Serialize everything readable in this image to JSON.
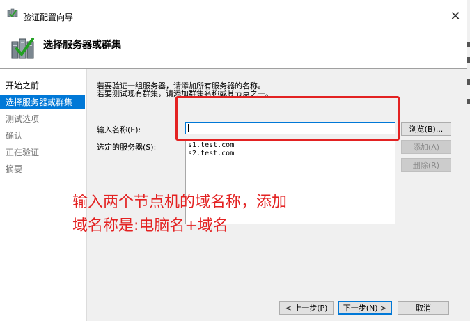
{
  "window": {
    "title": "验证配置向导",
    "close_glyph": "✕"
  },
  "header": {
    "title": "选择服务器或群集",
    "icon": "cluster-validate-icon"
  },
  "nav": {
    "items": [
      {
        "label": "开始之前",
        "state": "normal"
      },
      {
        "label": "选择服务器或群集",
        "state": "selected"
      },
      {
        "label": "测试选项",
        "state": "disabled"
      },
      {
        "label": "确认",
        "state": "disabled"
      },
      {
        "label": "正在验证",
        "state": "disabled"
      },
      {
        "label": "摘要",
        "state": "disabled"
      }
    ]
  },
  "content": {
    "desc_line1": "若要验证一组服务器，请添加所有服务器的名称。",
    "desc_line2": "若要测试现有群集，请添加群集名称或其节点之一。",
    "name_label": "输入名称(E):",
    "name_value": "",
    "servers_label": "选定的服务器(S):",
    "servers": [
      "s1.test.com",
      "s2.test.com"
    ],
    "browse_button": "浏览(B)...",
    "add_button": "添加(A)",
    "remove_button": "删除(R)"
  },
  "footer": {
    "prev_button": "< 上一步(P)",
    "next_button": "下一步(N) >",
    "cancel_button": "取消"
  },
  "annotation": {
    "line1": "输入两个节点机的域名称，添加",
    "line2": "域名称是:电脑名+域名",
    "color": "#e32222"
  },
  "colors": {
    "accent": "#0078d7",
    "annotation_red": "#e32222",
    "content_bg": "#f0f0f0"
  }
}
